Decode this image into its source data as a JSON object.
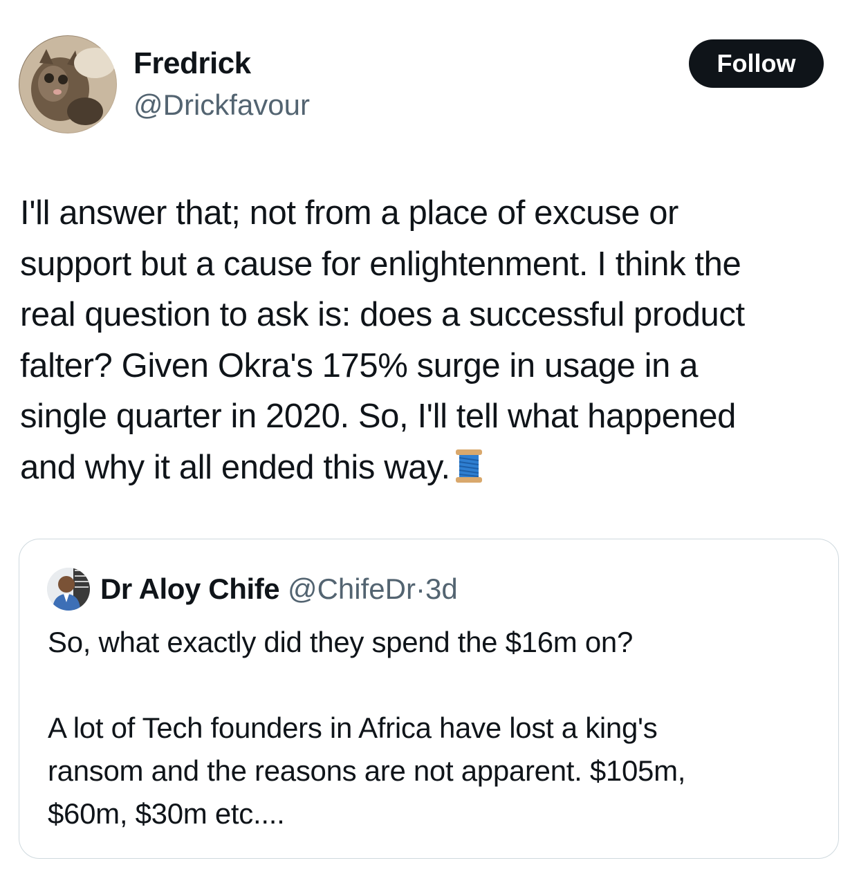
{
  "tweet": {
    "author": {
      "display_name": "Fredrick",
      "handle": "@Drickfavour",
      "avatar_icon": "cat-avatar-icon"
    },
    "follow_label": "Follow",
    "text": "I'll answer that; not from a place of excuse or\nsupport but a cause for enlightenment. I think the\nreal question to ask is: does a successful product\nfalter? Given Okra's 175% surge in usage in a\nsingle quarter in 2020. So, I'll tell what happened\nand why it all ended this way.",
    "trailing_icon": "thread-spool-icon"
  },
  "quoted_tweet": {
    "display_name": "Dr Aloy Chife",
    "handle": "@ChifeDr",
    "separator": "·",
    "time": "3d",
    "text": "So, what exactly did they spend the $16m on?\n\nA lot of Tech founders in Africa have lost a king's\nransom and the reasons are not apparent. $105m,\n$60m, $30m etc...."
  },
  "colors": {
    "text_primary": "#0f1419",
    "text_secondary": "#536471",
    "button_bg": "#0f1419",
    "border": "#cfd9de"
  }
}
